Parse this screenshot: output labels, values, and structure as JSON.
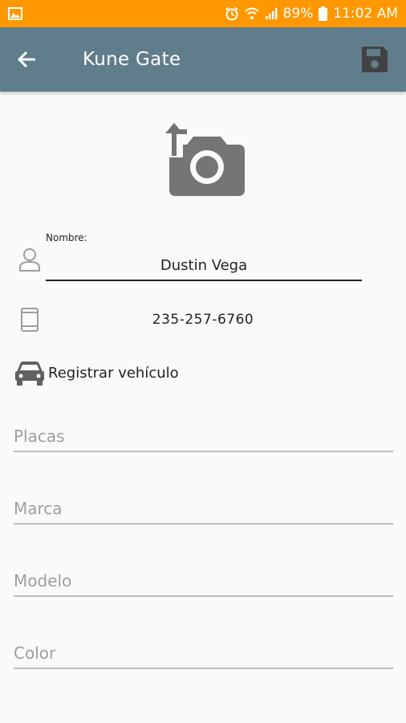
{
  "status_bar": {
    "battery": "89%",
    "time": "11:02 AM",
    "icons": [
      "image-icon",
      "alarm-icon",
      "wifi-icon",
      "signal-icon",
      "battery-icon"
    ]
  },
  "app_bar": {
    "title": "Kune Gate",
    "back_icon": "arrow-back-icon",
    "save_icon": "save-icon",
    "background": "#607d8b"
  },
  "profile": {
    "photo_icon": "camera-switch-icon",
    "name_label": "Nombre:",
    "name_value": "Dustin Vega",
    "phone_value": "235-257-6760"
  },
  "vehicle": {
    "header_label": "Registrar vehículo",
    "fields": [
      {
        "placeholder": "Placas",
        "value": ""
      },
      {
        "placeholder": "Marca",
        "value": ""
      },
      {
        "placeholder": "Modelo",
        "value": ""
      },
      {
        "placeholder": "Color",
        "value": ""
      }
    ]
  },
  "colors": {
    "status_bar": "#ff9800",
    "icon_gray": "#757575",
    "placeholder": "#9e9e9e"
  }
}
